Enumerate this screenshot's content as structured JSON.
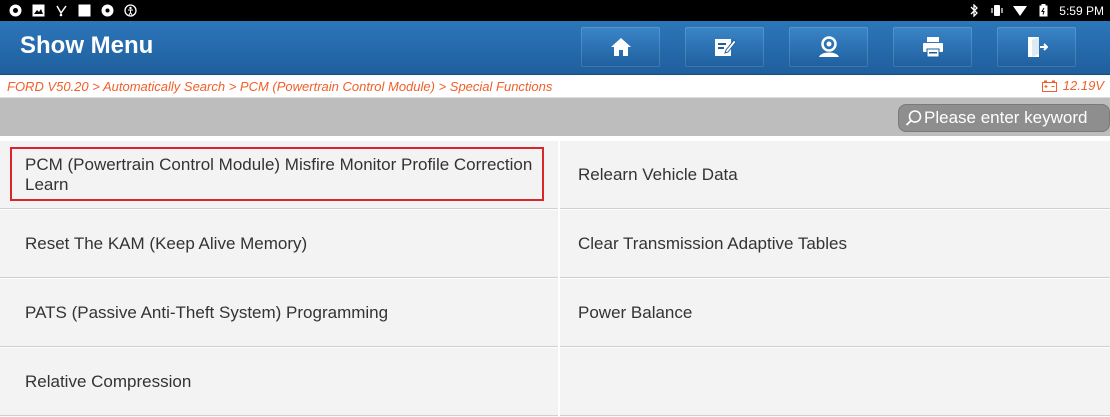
{
  "status_bar": {
    "time": "5:59 PM"
  },
  "titlebar": {
    "title": "Show Menu",
    "buttons": [
      "home-icon",
      "edit-report-icon",
      "user-profile-icon",
      "print-icon",
      "exit-icon"
    ]
  },
  "breadcrumb": {
    "path": "FORD V50.20 > Automatically Search > PCM (Powertrain Control Module) > Special Functions",
    "voltage": "12.19V"
  },
  "search": {
    "placeholder": "Please enter keyword"
  },
  "functions": {
    "items": [
      "PCM (Powertrain Control Module) Misfire Monitor Profile Correction Learn",
      "Relearn Vehicle Data",
      "Reset The KAM (Keep Alive Memory)",
      "Clear Transmission Adaptive Tables",
      "PATS (Passive Anti-Theft System) Programming",
      "Power Balance",
      "Relative Compression"
    ]
  },
  "colors": {
    "title_bar": "#1f5f9e",
    "breadcrumb_text": "#f0602a",
    "highlight_border": "#d9262b",
    "cell_background": "#f3f3f3",
    "search_strip": "#bdbdbd"
  }
}
